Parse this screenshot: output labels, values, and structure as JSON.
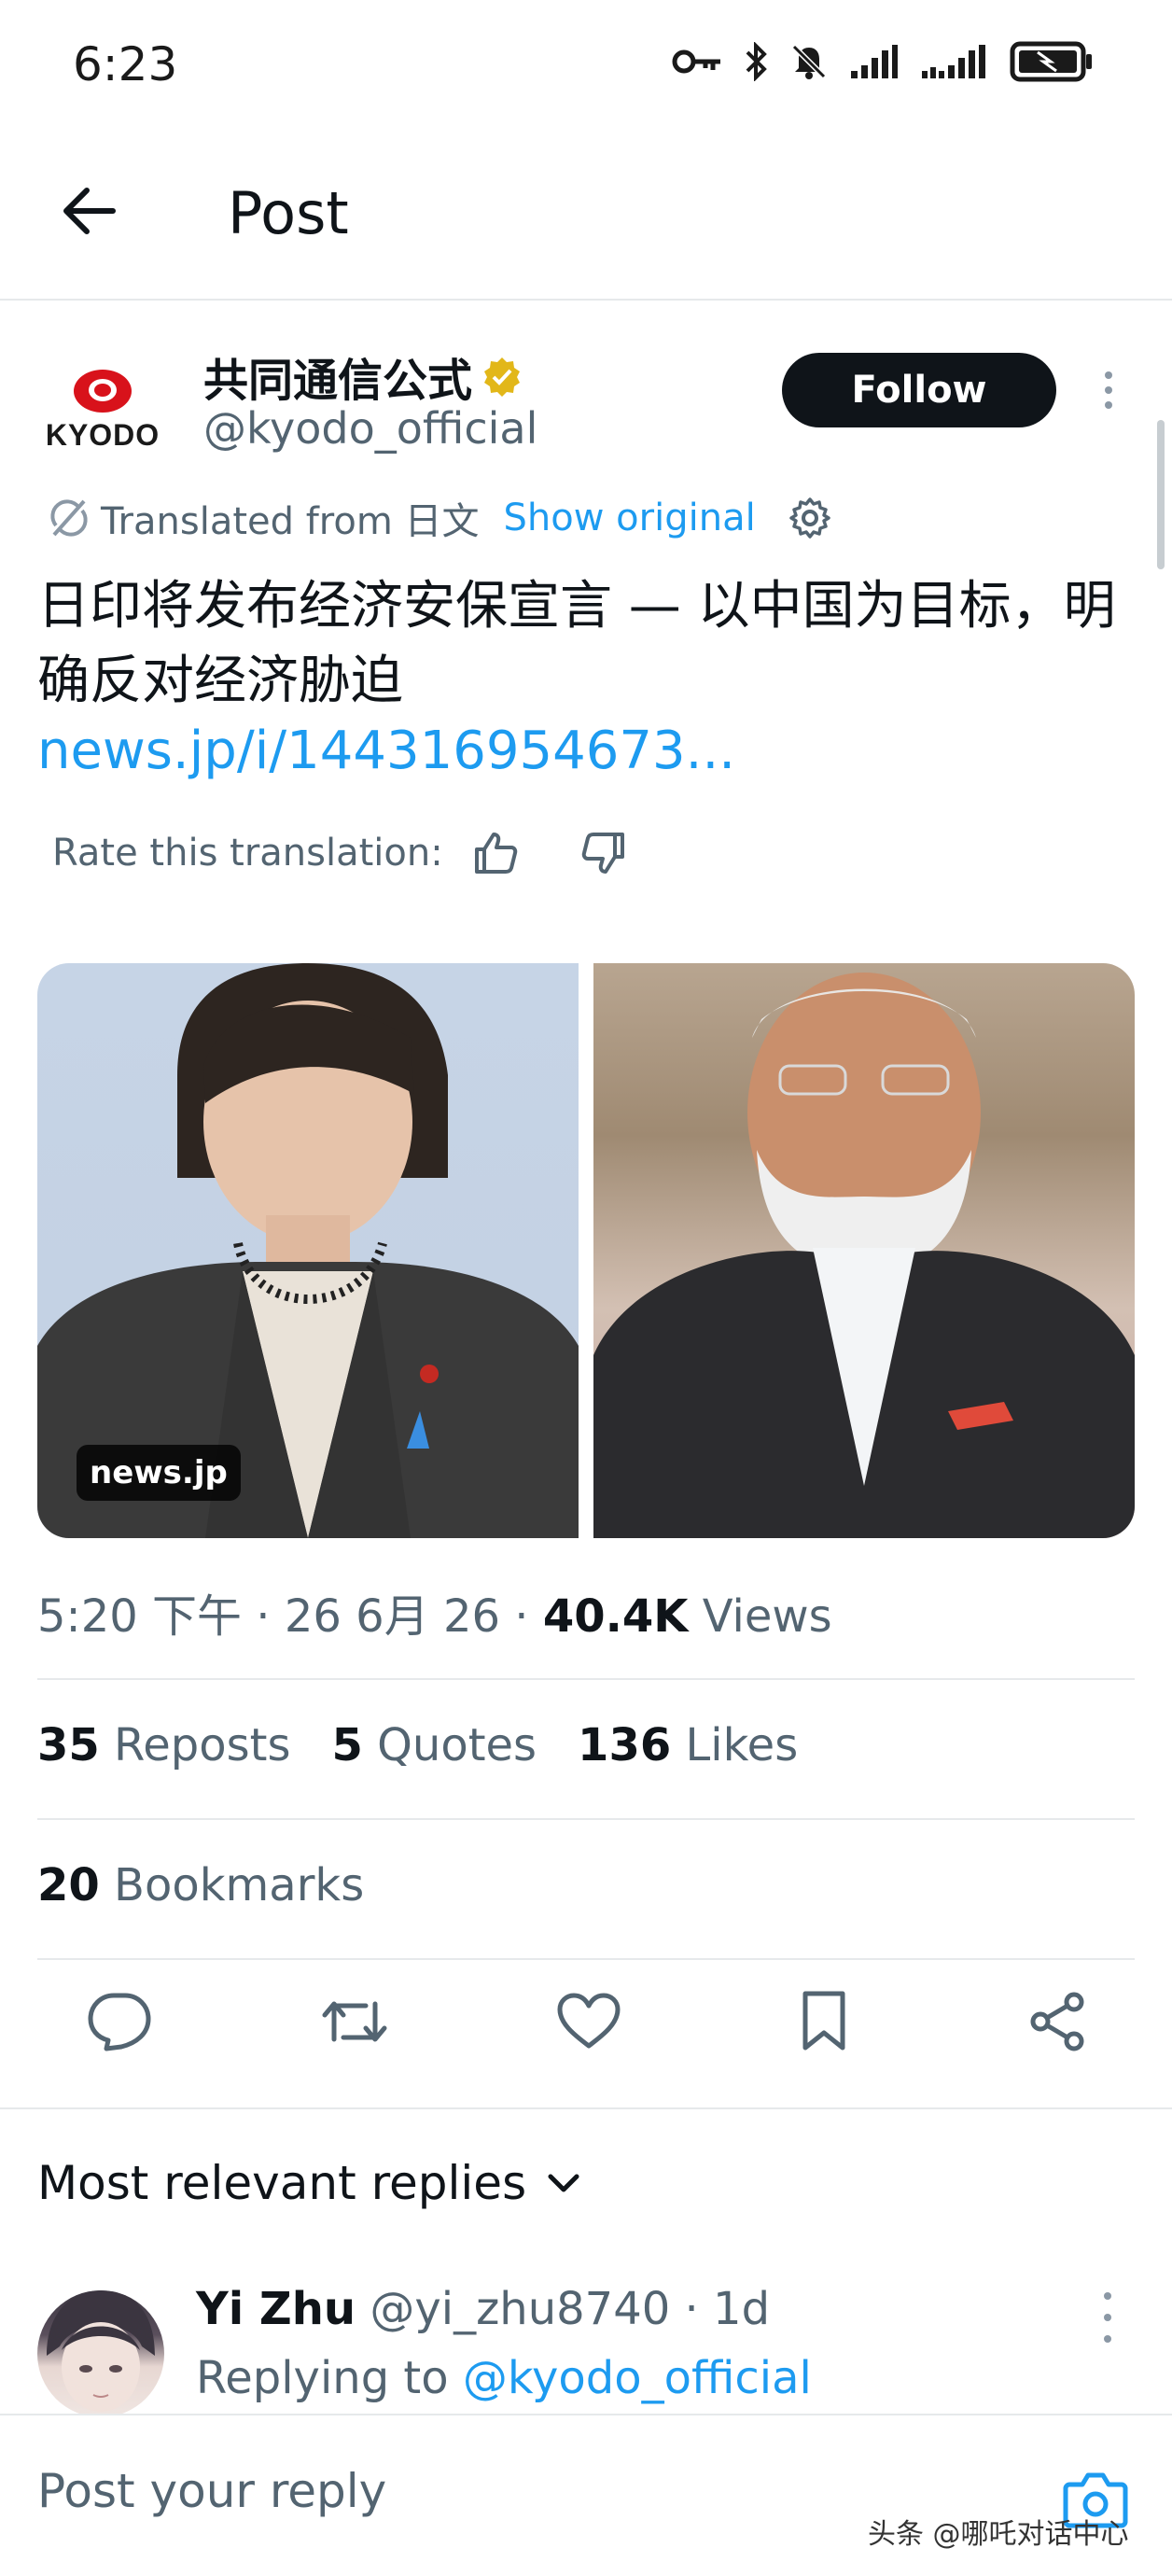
{
  "status_bar": {
    "time": "6:23"
  },
  "header": {
    "title": "Post"
  },
  "author": {
    "logo_text": "KYODO",
    "name": "共同通信公式",
    "handle": "@kyodo_official",
    "follow_label": "Follow",
    "verified_color": "#e2b719"
  },
  "translation": {
    "label": "Translated from 日文",
    "show_original": "Show original"
  },
  "post": {
    "text": "日印将发布经济安保宣言 — 以中国为目标，明确反对经济胁迫",
    "link": "news.jp/i/144316954673...",
    "rate_label": "Rate this translation:",
    "media_badge": "news.jp"
  },
  "meta": {
    "time": "5:20 下午 · 26 6月 26 · ",
    "views_count": "40.4K",
    "views_label": " Views"
  },
  "stats": {
    "reposts_count": "35",
    "reposts_label": " Reposts",
    "quotes_count": "5",
    "quotes_label": " Quotes",
    "likes_count": "136",
    "likes_label": " Likes",
    "bookmarks_count": "20",
    "bookmarks_label": " Bookmarks"
  },
  "replies": {
    "sort_label": "Most relevant replies",
    "first": {
      "name": "Yi Zhu",
      "handle": " @yi_zhu8740 · 1d",
      "replying_prefix": "Replying to ",
      "replying_handle": "@kyodo_official"
    }
  },
  "composer": {
    "placeholder": "Post your reply"
  },
  "watermark": "头条 @哪吒对话中心",
  "colors": {
    "accent": "#1d9bf0",
    "text": "#0f1419",
    "muted": "#536471"
  }
}
